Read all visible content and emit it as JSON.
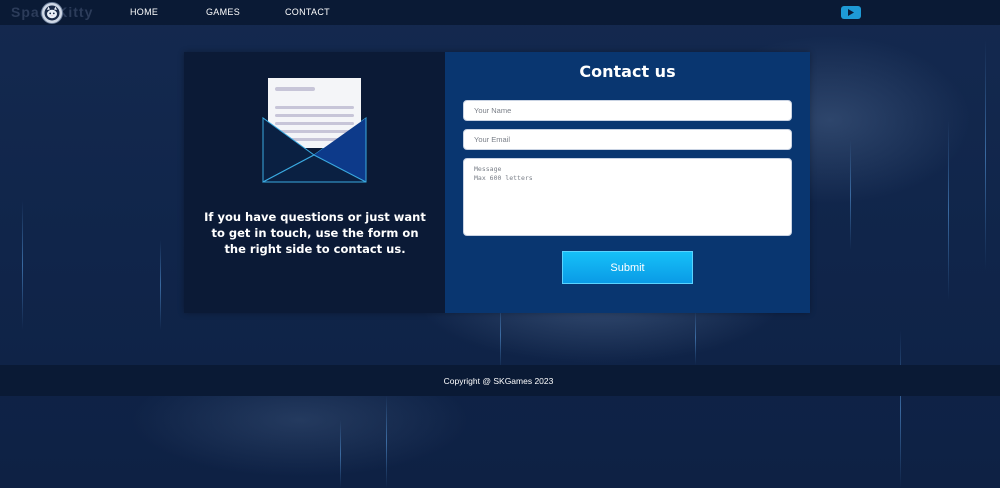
{
  "brand": {
    "name": "SpaceKitty"
  },
  "nav": {
    "links": [
      {
        "label": "HOME"
      },
      {
        "label": "GAMES"
      },
      {
        "label": "CONTACT"
      }
    ],
    "social_icon": "youtube-icon"
  },
  "contact": {
    "title": "Contact us",
    "intro_text": "If you have questions or just want to get in touch, use the form on the right side to contact us.",
    "name_placeholder": "Your Name",
    "email_placeholder": "Your Email",
    "message_placeholder": "Message\nMax 600 letters",
    "submit_label": "Submit"
  },
  "footer": {
    "copyright": "Copyright @ SKGames 2023"
  },
  "colors": {
    "navbar_bg": "#0a1a35",
    "card_left_bg": "#0b1a36",
    "card_right_bg": "#093670",
    "submit_bg": "#0ab0f0",
    "youtube_button": "#1e9ad6"
  }
}
